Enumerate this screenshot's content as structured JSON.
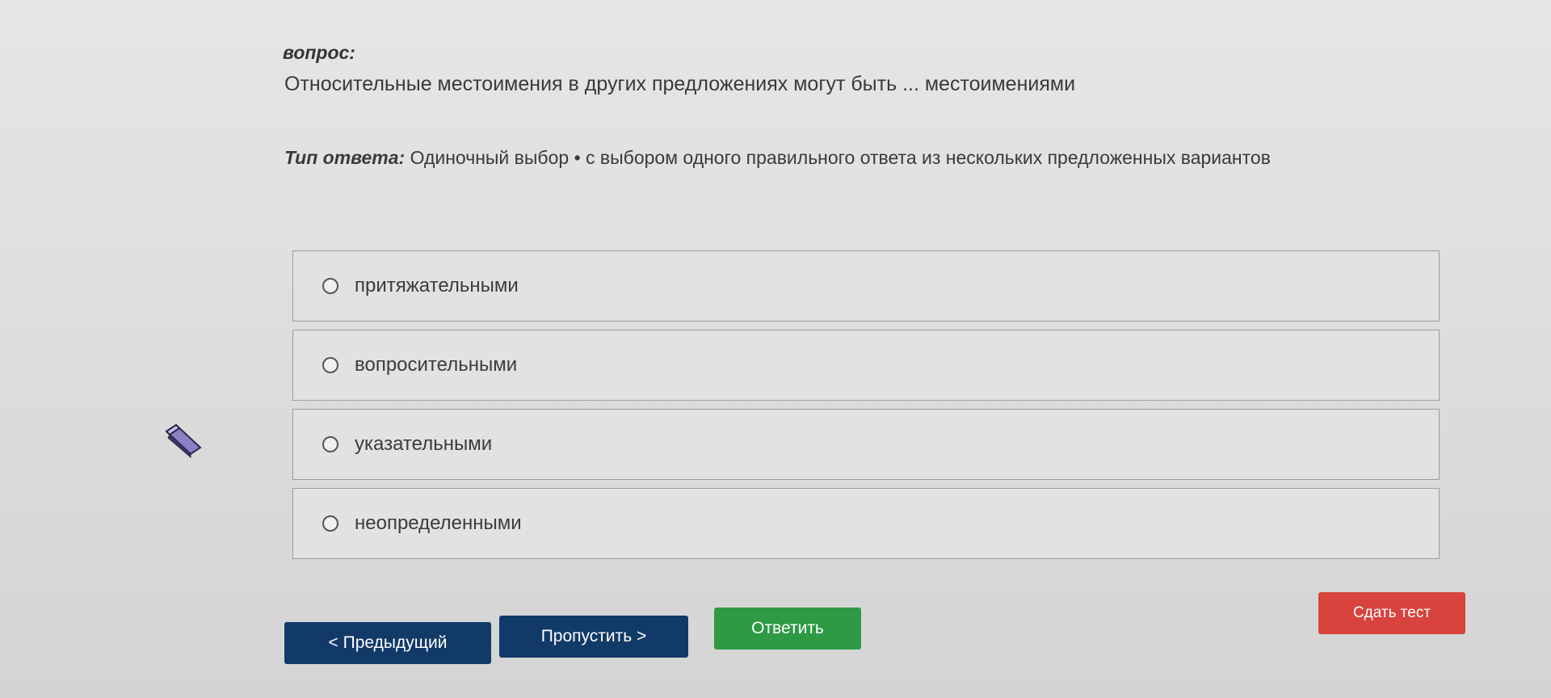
{
  "question": {
    "label": "вопрос:",
    "text": "Относительные местоимения в других предложениях могут быть ... местоимениями"
  },
  "answer_type": {
    "key": "Тип ответа:",
    "value": "Одиночный выбор • с выбором одного правильного ответа из нескольких предложенных вариантов"
  },
  "options": [
    {
      "label": "притяжательными"
    },
    {
      "label": "вопросительными"
    },
    {
      "label": "указательными"
    },
    {
      "label": "неопределенными"
    }
  ],
  "buttons": {
    "prev": "< Предыдущий",
    "skip": "Пропустить >",
    "answer": "Ответить",
    "submit": "Сдать тест"
  },
  "colors": {
    "nav_button": "#123a68",
    "answer_button": "#2e9a44",
    "submit_button": "#d8433d"
  },
  "icons": {
    "cursor": "eraser-cursor-icon"
  }
}
